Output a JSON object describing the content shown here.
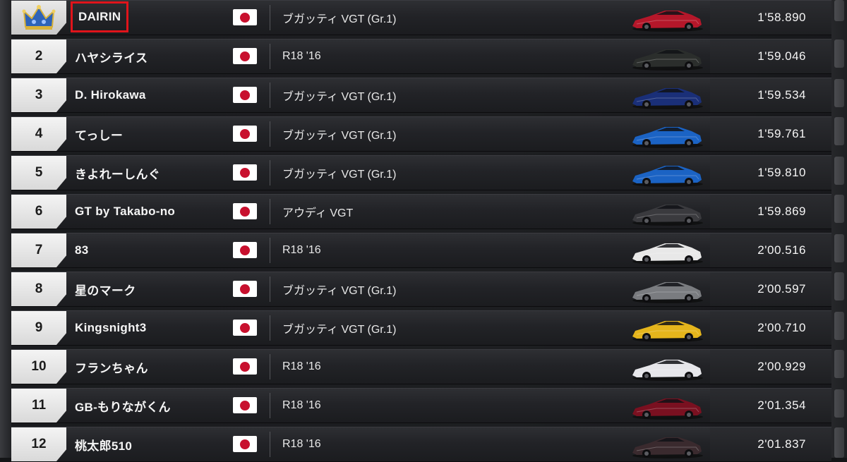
{
  "leaderboard": {
    "rows": [
      {
        "rank": "",
        "rank_icon": "crown-icon",
        "name": "DAIRIN",
        "highlighted": true,
        "flag": "japan-flag-icon",
        "car": "ブガッティ VGT (Gr.1)",
        "car_color": "#b5172a",
        "time": "1'58.890"
      },
      {
        "rank": "2",
        "name": "ハヤシライス",
        "flag": "japan-flag-icon",
        "car": "R18 '16",
        "car_color": "#2b2e2c",
        "time": "1'59.046"
      },
      {
        "rank": "3",
        "name": "D. Hirokawa",
        "flag": "japan-flag-icon",
        "car": "ブガッティ VGT (Gr.1)",
        "car_color": "#1a2f78",
        "time": "1'59.534"
      },
      {
        "rank": "4",
        "name": "てっしー",
        "flag": "japan-flag-icon",
        "car": "ブガッティ VGT (Gr.1)",
        "car_color": "#1b63c4",
        "time": "1'59.761"
      },
      {
        "rank": "5",
        "name": "きよれーしんぐ",
        "flag": "japan-flag-icon",
        "car": "ブガッティ VGT (Gr.1)",
        "car_color": "#1b63c4",
        "time": "1'59.810"
      },
      {
        "rank": "6",
        "name": "GT by Takabo-no",
        "flag": "japan-flag-icon",
        "car": "アウディ VGT",
        "car_color": "#3a3a3e",
        "time": "1'59.869"
      },
      {
        "rank": "7",
        "name": "83",
        "flag": "japan-flag-icon",
        "car": "R18 '16",
        "car_color": "#e8e8e8",
        "time": "2'00.516"
      },
      {
        "rank": "8",
        "name": "星のマーク",
        "flag": "japan-flag-icon",
        "car": "ブガッティ VGT (Gr.1)",
        "car_color": "#7a7c80",
        "time": "2'00.597"
      },
      {
        "rank": "9",
        "name": "Kingsnight3",
        "flag": "japan-flag-icon",
        "car": "ブガッティ VGT (Gr.1)",
        "car_color": "#e5b51c",
        "time": "2'00.710"
      },
      {
        "rank": "10",
        "name": "フランちゃん",
        "flag": "japan-flag-icon",
        "car": "R18 '16",
        "car_color": "#e6e6ea",
        "time": "2'00.929"
      },
      {
        "rank": "11",
        "name": "GB-もりながくん",
        "flag": "japan-flag-icon",
        "car": "R18 '16",
        "car_color": "#7a1020",
        "time": "2'01.354"
      },
      {
        "rank": "12",
        "name": "桃太郎510",
        "flag": "japan-flag-icon",
        "car": "R18 '16",
        "car_color": "#3a2a2e",
        "time": "2'01.837"
      }
    ]
  },
  "colors": {
    "highlight_border": "#e0141b",
    "flag_red": "#c8102e"
  }
}
